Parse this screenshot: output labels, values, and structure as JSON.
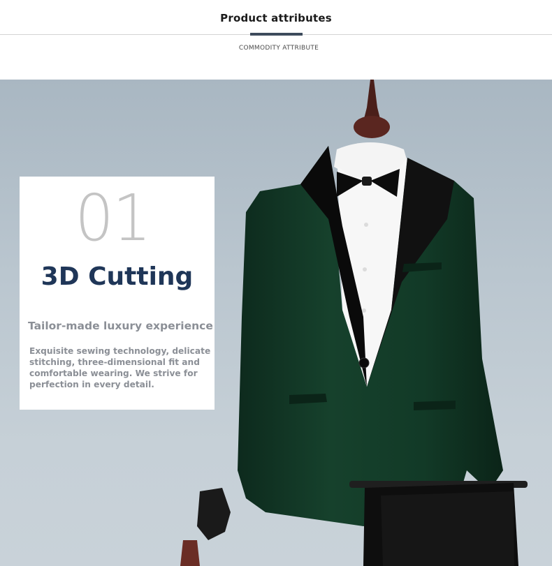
{
  "header": {
    "title": "Product attributes",
    "subtitle": "COMMODITY ATTRIBUTE"
  },
  "feature": {
    "number": "01",
    "title": "3D Cutting",
    "subtitle": "Tailor-made luxury experience",
    "description": "Exquisite sewing technology, delicate stitching, three-dimensional fit and comfortable wearing. We strive for perfection in every detail."
  },
  "colors": {
    "header_accent": "#3d4b5c",
    "title": "#1f3658",
    "body_text": "#8b8f96",
    "jacket": "#123524",
    "background": "#bac6cf"
  }
}
